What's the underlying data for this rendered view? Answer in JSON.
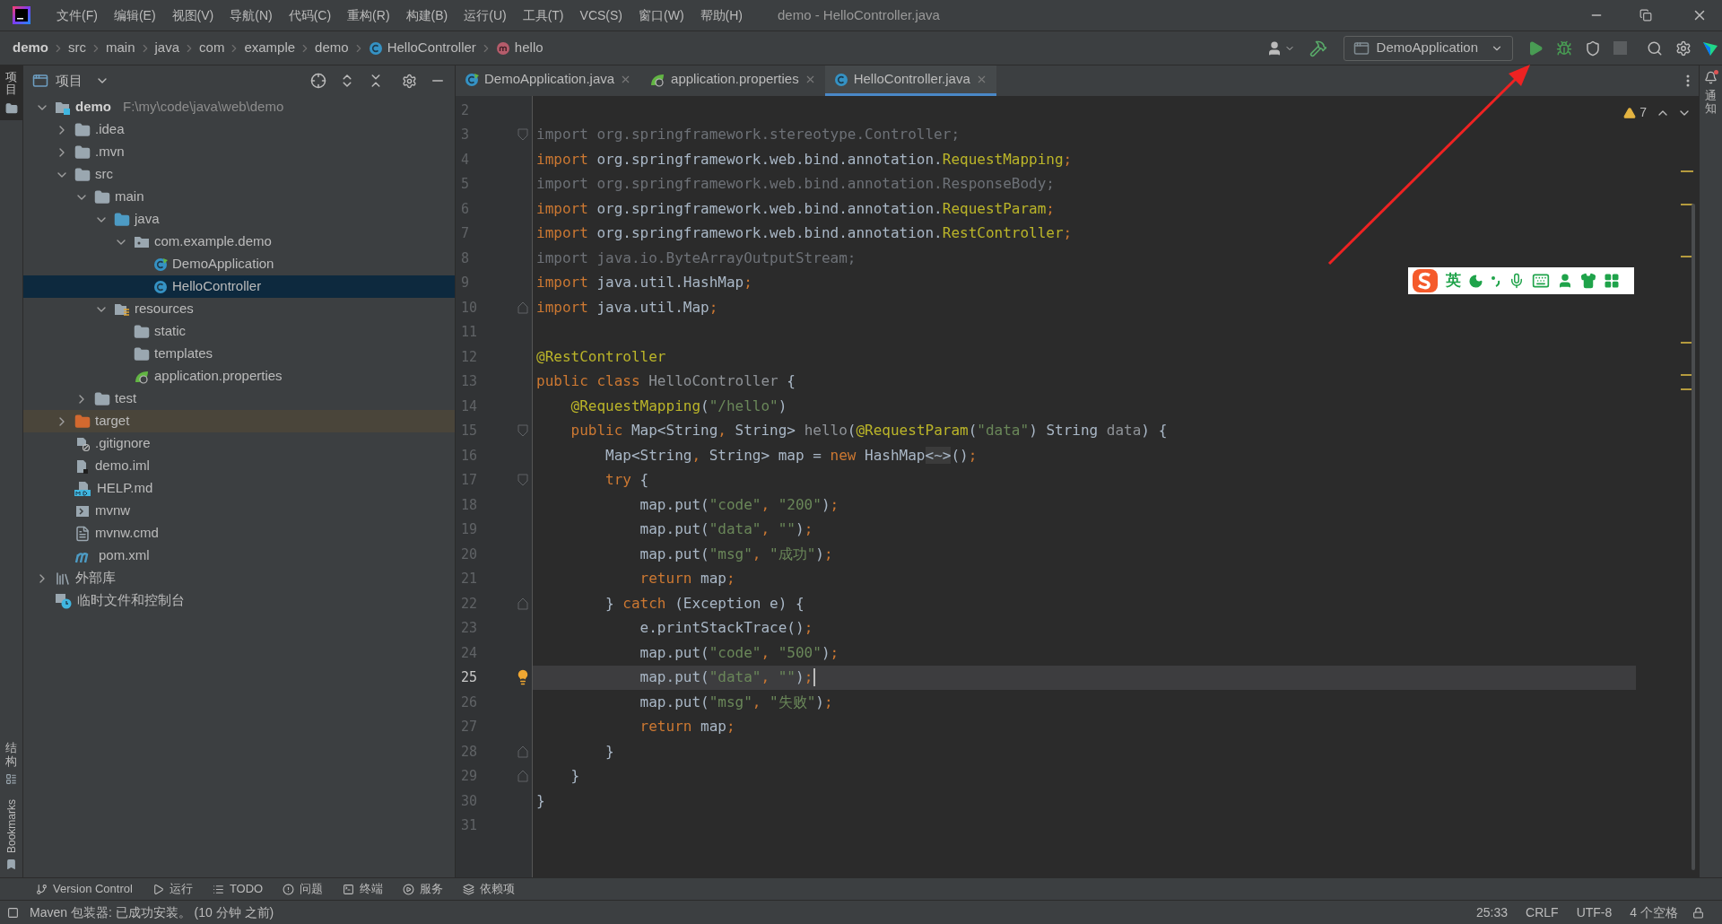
{
  "window": {
    "title": "demo - HelloController.java"
  },
  "menu": [
    "文件(F)",
    "编辑(E)",
    "视图(V)",
    "导航(N)",
    "代码(C)",
    "重构(R)",
    "构建(B)",
    "运行(U)",
    "工具(T)",
    "VCS(S)",
    "窗口(W)",
    "帮助(H)"
  ],
  "breadcrumb": [
    {
      "label": "demo",
      "kind": "project"
    },
    {
      "label": "src",
      "kind": "folder"
    },
    {
      "label": "main",
      "kind": "folder"
    },
    {
      "label": "java",
      "kind": "folder"
    },
    {
      "label": "com",
      "kind": "folder"
    },
    {
      "label": "example",
      "kind": "folder"
    },
    {
      "label": "demo",
      "kind": "folder"
    },
    {
      "label": "HelloController",
      "kind": "class"
    },
    {
      "label": "hello",
      "kind": "method"
    }
  ],
  "run_config": {
    "label": "DemoApplication",
    "stop_disabled": true
  },
  "left_stripe_top": [
    {
      "label": "项目",
      "kind": "project",
      "selected": true
    }
  ],
  "left_stripe_bottom": [
    {
      "label": "结构",
      "kind": "structure",
      "selected": false
    },
    {
      "label": "Bookmarks",
      "kind": "bookmarks",
      "selected": false
    }
  ],
  "project_panel": {
    "title": "项目",
    "tree": [
      {
        "label": "demo",
        "kind": "module",
        "path": "F:\\my\\code\\java\\web\\demo",
        "expanded": true,
        "selected": false,
        "children": [
          {
            "label": ".idea",
            "kind": "folder",
            "expanded": false,
            "selected": false
          },
          {
            "label": ".mvn",
            "kind": "folder",
            "expanded": false,
            "selected": false
          },
          {
            "label": "src",
            "kind": "folder",
            "expanded": true,
            "selected": false,
            "children": [
              {
                "label": "main",
                "kind": "folder",
                "expanded": true,
                "selected": false,
                "children": [
                  {
                    "label": "java",
                    "kind": "source-folder",
                    "expanded": true,
                    "selected": false,
                    "children": [
                      {
                        "label": "com.example.demo",
                        "kind": "package",
                        "expanded": true,
                        "selected": false,
                        "children": [
                          {
                            "label": "DemoApplication",
                            "kind": "spring-class",
                            "selected": false
                          },
                          {
                            "label": "HelloController",
                            "kind": "class",
                            "selected": true
                          }
                        ]
                      }
                    ]
                  },
                  {
                    "label": "resources",
                    "kind": "resource-folder",
                    "expanded": true,
                    "selected": false,
                    "children": [
                      {
                        "label": "static",
                        "kind": "folder",
                        "selected": false
                      },
                      {
                        "label": "templates",
                        "kind": "folder",
                        "selected": false
                      },
                      {
                        "label": "application.properties",
                        "kind": "properties",
                        "selected": false
                      }
                    ]
                  }
                ]
              },
              {
                "label": "test",
                "kind": "folder",
                "expanded": false,
                "selected": false
              }
            ]
          },
          {
            "label": "target",
            "kind": "excluded-folder",
            "expanded": false,
            "selected": false
          },
          {
            "label": ".gitignore",
            "kind": "ignore-file",
            "selected": false
          },
          {
            "label": "demo.iml",
            "kind": "iml",
            "selected": false
          },
          {
            "label": "HELP.md",
            "kind": "md",
            "selected": false
          },
          {
            "label": "mvnw",
            "kind": "script",
            "selected": false
          },
          {
            "label": "mvnw.cmd",
            "kind": "text",
            "selected": false
          },
          {
            "label": "pom.xml",
            "kind": "maven",
            "selected": false
          }
        ]
      },
      {
        "label": "外部库",
        "kind": "libraries",
        "expanded": false,
        "selected": false
      },
      {
        "label": "临时文件和控制台",
        "kind": "scratches",
        "selected": false
      }
    ]
  },
  "tabs": [
    {
      "label": "DemoApplication.java",
      "kind": "spring-class",
      "selected": false
    },
    {
      "label": "application.properties",
      "kind": "properties",
      "selected": false
    },
    {
      "label": "HelloController.java",
      "kind": "class",
      "selected": true
    }
  ],
  "inspections": {
    "count": "7"
  },
  "lines": [
    {
      "number": "2",
      "current": false
    },
    {
      "number": "3",
      "current": false,
      "gutter": {
        "kind": "fold-start"
      },
      "tokens": [
        {
          "kind": "unused",
          "text": "import org.springframework.stereotype.Controller;"
        }
      ]
    },
    {
      "number": "4",
      "current": false,
      "tokens": [
        {
          "kind": "kw",
          "text": "import"
        },
        {
          "kind": "id",
          "text": " org.springframework.web.bind.annotation."
        },
        {
          "kind": "ann",
          "text": "RequestMapping"
        },
        {
          "kind": "kw",
          "text": ";"
        }
      ]
    },
    {
      "number": "5",
      "current": false,
      "tokens": [
        {
          "kind": "unused",
          "text": "import org.springframework.web.bind.annotation.ResponseBody;"
        }
      ]
    },
    {
      "number": "6",
      "current": false,
      "tokens": [
        {
          "kind": "kw",
          "text": "import"
        },
        {
          "kind": "id",
          "text": " org.springframework.web.bind.annotation."
        },
        {
          "kind": "ann",
          "text": "RequestParam"
        },
        {
          "kind": "kw",
          "text": ";"
        }
      ]
    },
    {
      "number": "7",
      "current": false,
      "tokens": [
        {
          "kind": "kw",
          "text": "import"
        },
        {
          "kind": "id",
          "text": " org.springframework.web.bind.annotation."
        },
        {
          "kind": "ann",
          "text": "RestController"
        },
        {
          "kind": "kw",
          "text": ";"
        }
      ]
    },
    {
      "number": "8",
      "current": false,
      "tokens": [
        {
          "kind": "unused",
          "text": "import java.io.ByteArrayOutputStream;"
        }
      ]
    },
    {
      "number": "9",
      "current": false,
      "tokens": [
        {
          "kind": "kw",
          "text": "import"
        },
        {
          "kind": "id",
          "text": " java.util.HashMap"
        },
        {
          "kind": "kw",
          "text": ";"
        }
      ]
    },
    {
      "number": "10",
      "current": false,
      "gutter": {
        "kind": "fold-end"
      },
      "tokens": [
        {
          "kind": "kw",
          "text": "import"
        },
        {
          "kind": "id",
          "text": " java.util.Map"
        },
        {
          "kind": "kw",
          "text": ";"
        }
      ]
    },
    {
      "number": "11",
      "current": false
    },
    {
      "number": "12",
      "current": false,
      "tokens": [
        {
          "kind": "ann",
          "text": "@RestController"
        }
      ]
    },
    {
      "number": "13",
      "current": false,
      "tokens": [
        {
          "kind": "kw",
          "text": "public class "
        },
        {
          "kind": "dim",
          "text": "HelloController"
        },
        {
          "kind": "id",
          "text": " {"
        }
      ]
    },
    {
      "number": "14",
      "current": false,
      "tokens": [
        {
          "kind": "ann",
          "text": "    @RequestMapping"
        },
        {
          "kind": "id",
          "text": "("
        },
        {
          "kind": "str",
          "text": "\"/hello\""
        },
        {
          "kind": "id",
          "text": ")"
        }
      ]
    },
    {
      "number": "15",
      "current": false,
      "gutter": {
        "kind": "fold-start"
      },
      "tokens": [
        {
          "kind": "kw",
          "text": "    public "
        },
        {
          "kind": "id",
          "text": "Map<String"
        },
        {
          "kind": "kw",
          "text": ","
        },
        {
          "kind": "id",
          "text": " String> "
        },
        {
          "kind": "dim",
          "text": "hello"
        },
        {
          "kind": "id",
          "text": "("
        },
        {
          "kind": "ann",
          "text": "@RequestParam"
        },
        {
          "kind": "id",
          "text": "("
        },
        {
          "kind": "str",
          "text": "\"data\""
        },
        {
          "kind": "id",
          "text": ") String "
        },
        {
          "kind": "dim",
          "text": "data"
        },
        {
          "kind": "id",
          "text": ") {"
        }
      ]
    },
    {
      "number": "16",
      "current": false,
      "tokens": [
        {
          "kind": "id",
          "text": "        Map<String"
        },
        {
          "kind": "kw",
          "text": ","
        },
        {
          "kind": "id",
          "text": " String> map = "
        },
        {
          "kind": "kw",
          "text": "new "
        },
        {
          "kind": "id",
          "text": "HashMap"
        },
        {
          "kind": "folded",
          "text": "<~>"
        },
        {
          "kind": "id",
          "text": "()"
        },
        {
          "kind": "kw",
          "text": ";"
        }
      ]
    },
    {
      "number": "17",
      "current": false,
      "gutter": {
        "kind": "fold-start"
      },
      "tokens": [
        {
          "kind": "kw",
          "text": "        try "
        },
        {
          "kind": "id",
          "text": "{"
        }
      ]
    },
    {
      "number": "18",
      "current": false,
      "tokens": [
        {
          "kind": "id",
          "text": "            map.put("
        },
        {
          "kind": "str",
          "text": "\"code\""
        },
        {
          "kind": "kw",
          "text": ", "
        },
        {
          "kind": "str",
          "text": "\"200\""
        },
        {
          "kind": "id",
          "text": ")"
        },
        {
          "kind": "kw",
          "text": ";"
        }
      ]
    },
    {
      "number": "19",
      "current": false,
      "tokens": [
        {
          "kind": "id",
          "text": "            map.put("
        },
        {
          "kind": "str",
          "text": "\"data\""
        },
        {
          "kind": "kw",
          "text": ", "
        },
        {
          "kind": "str",
          "text": "\"\""
        },
        {
          "kind": "id",
          "text": ")"
        },
        {
          "kind": "kw",
          "text": ";"
        }
      ]
    },
    {
      "number": "20",
      "current": false,
      "tokens": [
        {
          "kind": "id",
          "text": "            map.put("
        },
        {
          "kind": "str",
          "text": "\"msg\""
        },
        {
          "kind": "kw",
          "text": ", "
        },
        {
          "kind": "str",
          "text": "\"成功\""
        },
        {
          "kind": "id",
          "text": ")"
        },
        {
          "kind": "kw",
          "text": ";"
        }
      ]
    },
    {
      "number": "21",
      "current": false,
      "tokens": [
        {
          "kind": "kw",
          "text": "            return "
        },
        {
          "kind": "id",
          "text": "map"
        },
        {
          "kind": "kw",
          "text": ";"
        }
      ]
    },
    {
      "number": "22",
      "current": false,
      "gutter": {
        "kind": "fold-end"
      },
      "tokens": [
        {
          "kind": "id",
          "text": "        } "
        },
        {
          "kind": "kw",
          "text": "catch "
        },
        {
          "kind": "id",
          "text": "(Exception e) {"
        }
      ]
    },
    {
      "number": "23",
      "current": false,
      "tokens": [
        {
          "kind": "id",
          "text": "            e.printStackTrace()"
        },
        {
          "kind": "kw",
          "text": ";"
        }
      ]
    },
    {
      "number": "24",
      "current": false,
      "tokens": [
        {
          "kind": "id",
          "text": "            map.put("
        },
        {
          "kind": "str",
          "text": "\"code\""
        },
        {
          "kind": "kw",
          "text": ", "
        },
        {
          "kind": "str",
          "text": "\"500\""
        },
        {
          "kind": "id",
          "text": ")"
        },
        {
          "kind": "kw",
          "text": ";"
        }
      ]
    },
    {
      "number": "25",
      "current": true,
      "gutter": {
        "kind": "bulb"
      },
      "tokens": [
        {
          "kind": "id",
          "text": "            map.put("
        },
        {
          "kind": "str",
          "text": "\"data\""
        },
        {
          "kind": "kw",
          "text": ", "
        },
        {
          "kind": "str",
          "text": "\"\""
        },
        {
          "kind": "id",
          "text": ")"
        },
        {
          "kind": "kw",
          "text": ";"
        }
      ]
    },
    {
      "number": "26",
      "current": false,
      "tokens": [
        {
          "kind": "id",
          "text": "            map.put("
        },
        {
          "kind": "str",
          "text": "\"msg\""
        },
        {
          "kind": "kw",
          "text": ", "
        },
        {
          "kind": "str",
          "text": "\"失败\""
        },
        {
          "kind": "id",
          "text": ")"
        },
        {
          "kind": "kw",
          "text": ";"
        }
      ]
    },
    {
      "number": "27",
      "current": false,
      "tokens": [
        {
          "kind": "kw",
          "text": "            return "
        },
        {
          "kind": "id",
          "text": "map"
        },
        {
          "kind": "kw",
          "text": ";"
        }
      ]
    },
    {
      "number": "28",
      "current": false,
      "gutter": {
        "kind": "fold-end"
      },
      "tokens": [
        {
          "kind": "id",
          "text": "        }"
        }
      ]
    },
    {
      "number": "29",
      "current": false,
      "gutter": {
        "kind": "fold-end"
      },
      "tokens": [
        {
          "kind": "id",
          "text": "    }"
        }
      ]
    },
    {
      "number": "30",
      "current": false,
      "tokens": [
        {
          "kind": "id",
          "text": "}"
        }
      ]
    },
    {
      "number": "31",
      "current": false
    }
  ],
  "right_stripe": [
    {
      "label": "通知",
      "kind": "notifications"
    }
  ],
  "ime_toolbar": {
    "mode": "英"
  },
  "tool_tabs": [
    {
      "label": "Version Control",
      "kind": "vcs"
    },
    {
      "label": "运行",
      "kind": "run"
    },
    {
      "label": "TODO",
      "kind": "todo"
    },
    {
      "label": "问题",
      "kind": "problems"
    },
    {
      "label": "终端",
      "kind": "terminal"
    },
    {
      "label": "服务",
      "kind": "services"
    },
    {
      "label": "依赖项",
      "kind": "dependencies"
    }
  ],
  "status_bar": {
    "message": "Maven 包装器: 已成功安装。 (10 分钟 之前)",
    "items": [
      "25:33",
      "CRLF",
      "UTF-8",
      "4 个空格"
    ]
  }
}
